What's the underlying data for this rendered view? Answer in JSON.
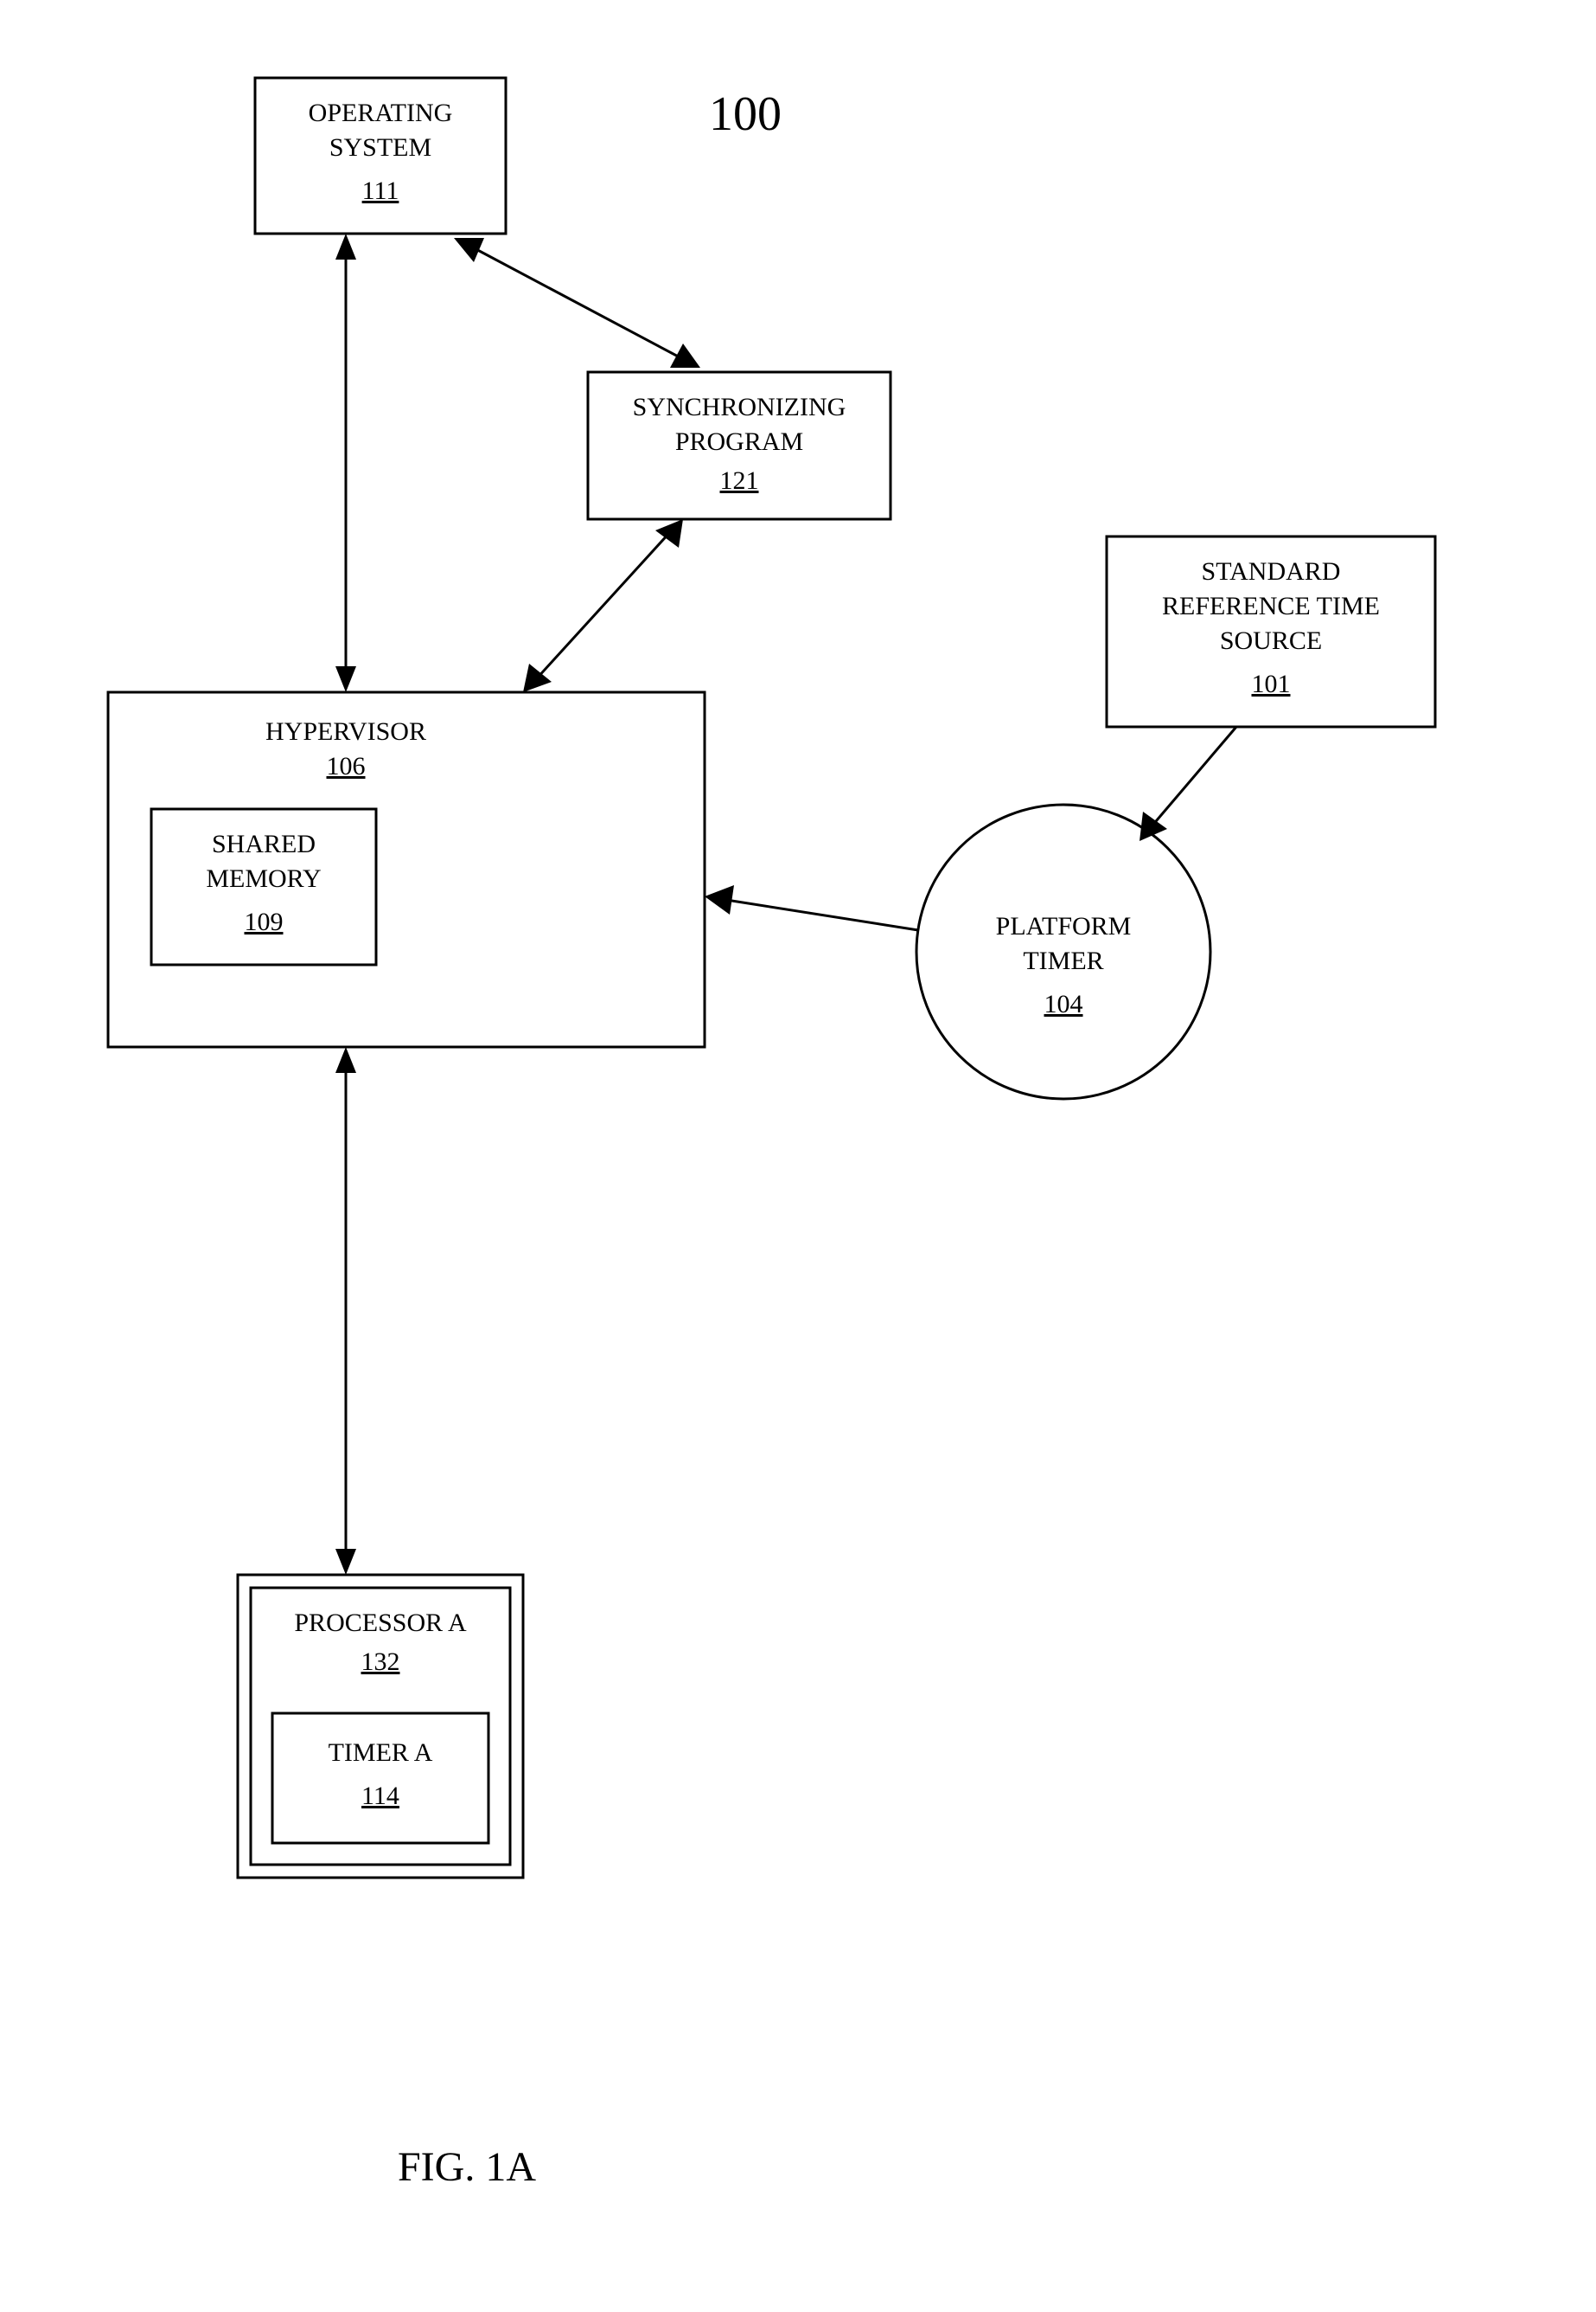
{
  "diagram": {
    "title_number": "100",
    "figure_label": "FIG. 1A",
    "boxes": {
      "operating_system": {
        "label": "OPERATING SYSTEM",
        "ref": "111"
      },
      "sync_program": {
        "label": "SYNCHRONIZING PROGRAM",
        "ref": "121"
      },
      "hypervisor": {
        "label": "HYPERVISOR",
        "ref": "106"
      },
      "shared_memory": {
        "label": "SHARED MEMORY",
        "ref": "109"
      },
      "std_ref": {
        "label": "STANDARD REFERENCE TIME SOURCE",
        "ref": "101"
      },
      "platform_timer": {
        "label": "PLATFORM TIMER",
        "ref": "104"
      },
      "processor_a": {
        "label": "PROCESSOR A",
        "ref": "132"
      },
      "timer_a": {
        "label": "TIMER A",
        "ref": "114"
      }
    }
  }
}
